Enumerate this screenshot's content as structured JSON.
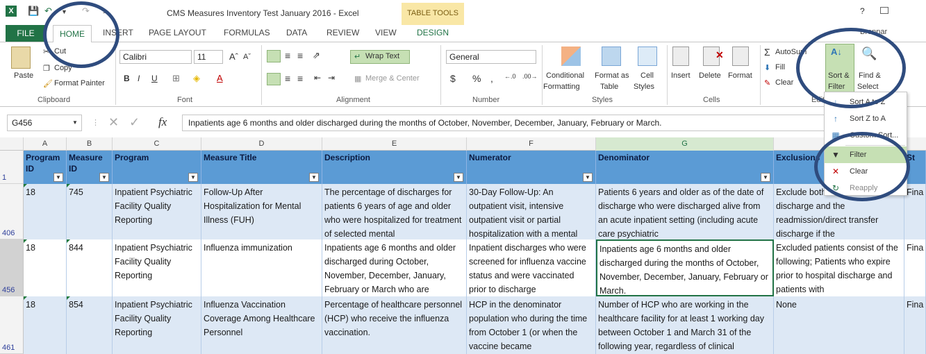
{
  "titlebar": {
    "app_icon": "X",
    "title": "CMS Measures Inventory Test January 2016 - Excel",
    "context_tab_group": "TABLE TOOLS",
    "help": "?"
  },
  "tabs": [
    "FILE",
    "HOME",
    "INSERT",
    "PAGE LAYOUT",
    "FORMULAS",
    "DATA",
    "REVIEW",
    "VIEW",
    "DESIGN"
  ],
  "user": "Brennar",
  "ribbon": {
    "clipboard": {
      "paste": "Paste",
      "cut": "Cut",
      "copy": "Copy",
      "format_painter": "Format Painter",
      "label": "Clipboard"
    },
    "font": {
      "name": "Calibri",
      "size": "11",
      "label": "Font"
    },
    "alignment": {
      "wrap_text": "Wrap Text",
      "merge_center": "Merge & Center",
      "label": "Alignment"
    },
    "number": {
      "format": "General",
      "currency": "$",
      "percent": "%",
      "comma": ",",
      "label": "Number"
    },
    "styles": {
      "conditional": "Conditional",
      "conditional2": "Formatting",
      "format_as": "Format as",
      "format_as2": "Table",
      "cell": "Cell",
      "cell2": "Styles",
      "label": "Styles"
    },
    "cells": {
      "insert": "Insert",
      "delete": "Delete",
      "format": "Format",
      "label": "Cells"
    },
    "editing": {
      "autosum": "AutoSum",
      "fill": "Fill",
      "clear": "Clear",
      "sort": "Sort &",
      "sort2": "Filter",
      "find": "Find &",
      "find2": "Select",
      "label": "Editing"
    }
  },
  "sort_menu": [
    "Sort A to Z",
    "Sort Z to A",
    "Custom Sort...",
    "Filter",
    "Clear",
    "Reapply"
  ],
  "formula_bar": {
    "name_box": "G456",
    "fx": "fx",
    "content": "Inpatients age 6 months and older discharged during the months of October, November, December, January, February or March."
  },
  "columns": [
    "A",
    "B",
    "C",
    "D",
    "E",
    "F",
    "G",
    "H"
  ],
  "header_row": {
    "row_num": "1",
    "cells": [
      "Program ID",
      "Measure ID",
      "Program",
      "Measure Title",
      "Description",
      "Numerator",
      "Denominator",
      "Exclusions",
      "St"
    ]
  },
  "rows": [
    {
      "row_num": "406",
      "cells": [
        "18",
        "745",
        "Inpatient Psychiatric Facility Quality Reporting",
        "Follow-Up After Hospitalization for Mental Illness (FUH)",
        "The percentage of discharges for patients 6 years of age and older who were hospitalized for treatment of selected mental",
        "30-Day Follow-Up: An outpatient visit, intensive outpatient visit or partial hospitalization with a mental",
        "Patients 6 years and older as of the date of discharge who were discharged alive from an acute inpatient setting (including acute care psychiatric",
        "Exclude both the initial discharge and the readmission/direct transfer discharge if the",
        "Fina"
      ]
    },
    {
      "row_num": "456",
      "cells": [
        "18",
        "844",
        "Inpatient Psychiatric Facility Quality Reporting",
        "Influenza immunization",
        "Inpatients age 6 months and older discharged during October, November, December, January, February or March who are",
        "Inpatient discharges who were screened for influenza vaccine status and were vaccinated prior to discharge",
        "Inpatients age 6 months and older discharged during the months of October, November, December, January, February or March.",
        "Excluded patients consist of the following; Patients who expire prior to hospital discharge and patients with",
        "Fina"
      ]
    },
    {
      "row_num": "461",
      "cells": [
        "18",
        "854",
        "Inpatient Psychiatric Facility Quality Reporting",
        "Influenza Vaccination Coverage Among Healthcare Personnel",
        "Percentage of healthcare personnel (HCP) who receive the influenza vaccination.",
        "HCP in the denominator population who during the time from October 1 (or when the vaccine became",
        "Number of HCP who are working in the healthcare facility for at least 1 working day between October 1 and March 31 of the following year, regardless of clinical",
        "None",
        "Fina"
      ]
    }
  ],
  "colors": {
    "excel_green": "#217346",
    "table_header": "#5b9bd5",
    "row_band": "#dde8f5",
    "annotation_circle": "#2f4c7e"
  }
}
